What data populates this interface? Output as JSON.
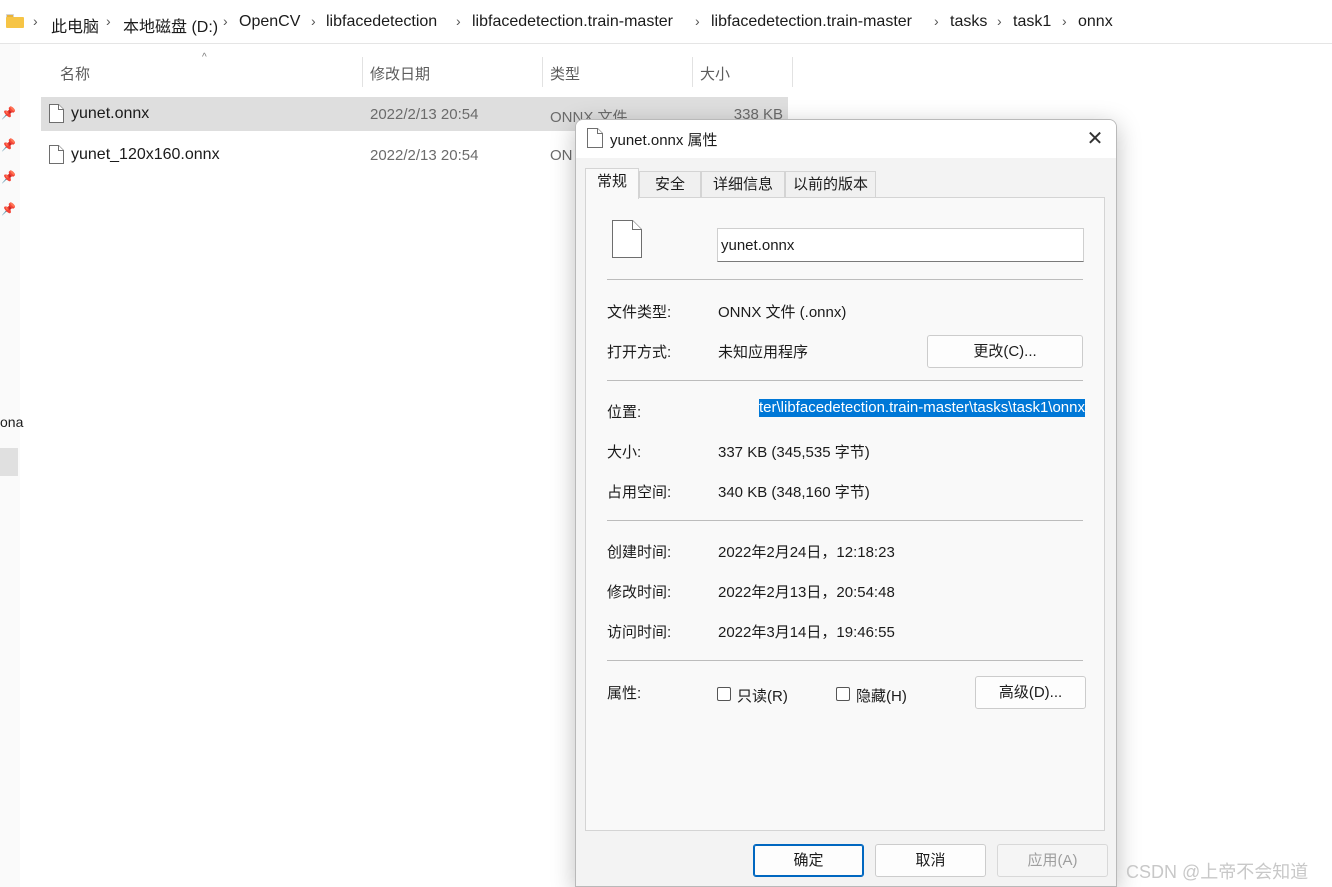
{
  "breadcrumb": {
    "items": [
      "此电脑",
      "本地磁盘 (D:)",
      "OpenCV",
      "libfacedetection",
      "libfacedetection.train-master",
      "libfacedetection.train-master",
      "tasks",
      "task1",
      "onnx"
    ]
  },
  "sidebar": {
    "partial_label": "ona"
  },
  "file_list": {
    "columns": {
      "name": "名称",
      "modified": "修改日期",
      "type": "类型",
      "size": "大小"
    },
    "rows": [
      {
        "name": "yunet.onnx",
        "modified": "2022/2/13 20:54",
        "type": "ONNX 文件",
        "size": "338 KB",
        "selected": true
      },
      {
        "name": "yunet_120x160.onnx",
        "modified": "2022/2/13 20:54",
        "type": "ON",
        "size": "",
        "selected": false
      }
    ]
  },
  "dialog": {
    "title": "yunet.onnx 属性",
    "close_icon": "✕",
    "tabs": [
      "常规",
      "安全",
      "详细信息",
      "以前的版本"
    ],
    "active_tab": "常规",
    "filename": "yunet.onnx",
    "labels": {
      "file_type": "文件类型:",
      "open_with": "打开方式:",
      "location": "位置:",
      "size": "大小:",
      "size_on_disk": "占用空间:",
      "created": "创建时间:",
      "modified": "修改时间:",
      "accessed": "访问时间:",
      "attributes": "属性:"
    },
    "values": {
      "file_type": "ONNX 文件 (.onnx)",
      "open_with": "未知应用程序",
      "location": "ter\\libfacedetection.train-master\\tasks\\task1\\onnx",
      "size": "337 KB (345,535 字节)",
      "size_on_disk": "340 KB (348,160 字节)",
      "created": "2022年2月24日，12:18:23",
      "modified": "2022年2月13日，20:54:48",
      "accessed": "2022年3月14日，19:46:55"
    },
    "change_button": "更改(C)...",
    "readonly_label": "只读(R)",
    "hidden_label": "隐藏(H)",
    "readonly_checked": false,
    "hidden_checked": false,
    "advanced_button": "高级(D)...",
    "ok_button": "确定",
    "cancel_button": "取消",
    "apply_button": "应用(A)"
  },
  "watermark": "CSDN @上帝不会知道",
  "colors": {
    "selection": "#0078d7",
    "folder": "#f6c445",
    "row_selected": "#dedede"
  }
}
